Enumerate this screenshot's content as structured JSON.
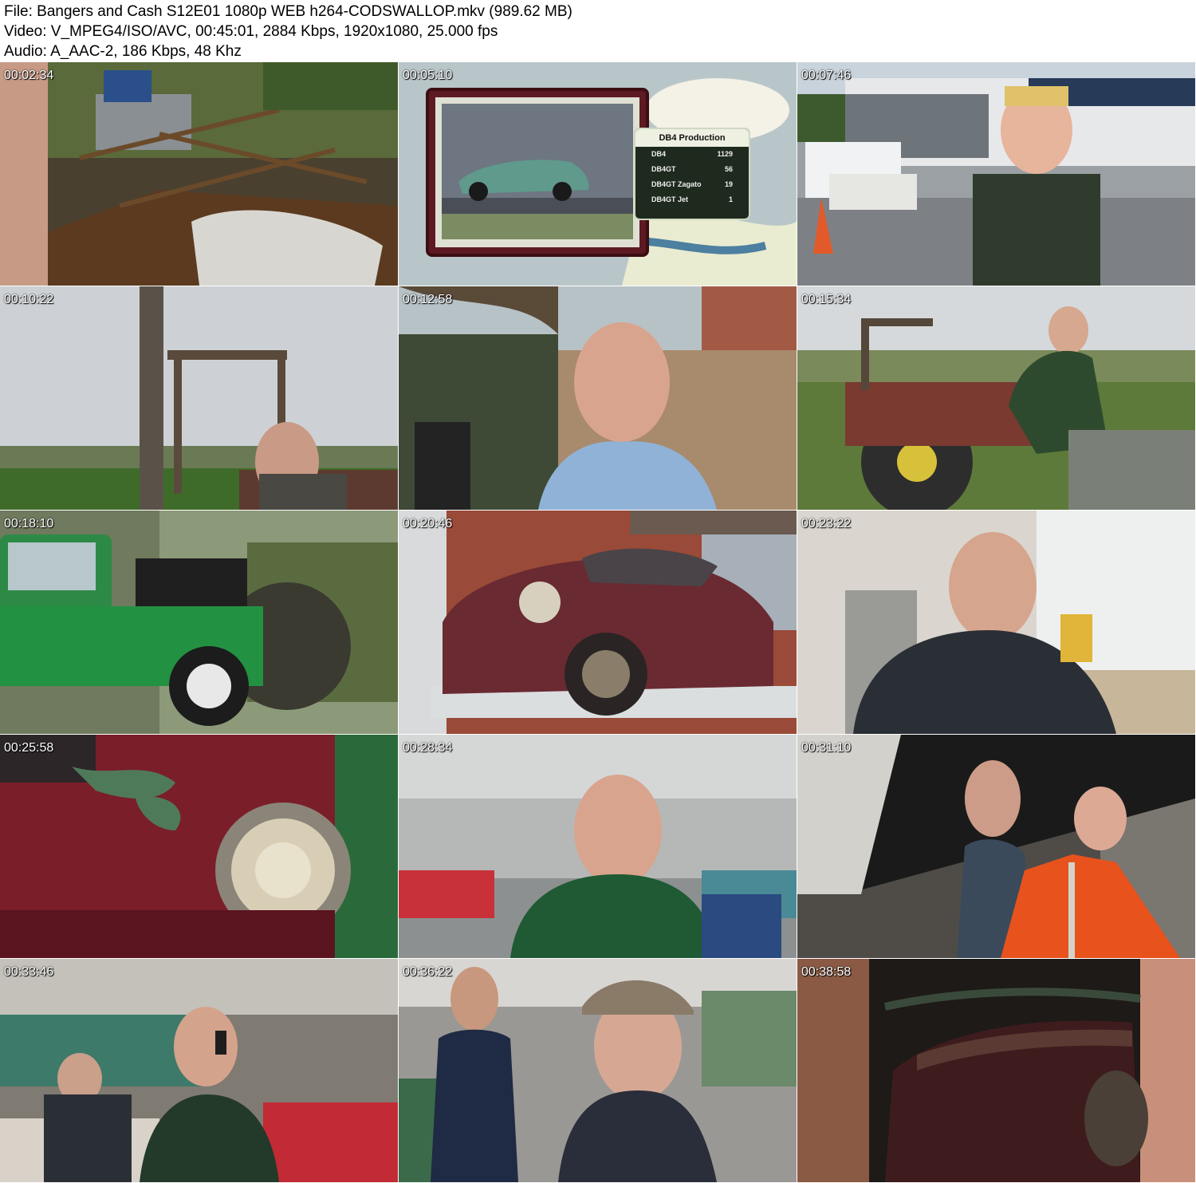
{
  "header": {
    "file_line": "File: Bangers and Cash S12E01 1080p WEB h264-CODSWALLOP.mkv (989.62 MB)",
    "video_line": "Video: V_MPEG4/ISO/AVC, 00:45:01, 2884 Kbps, 1920x1080, 25.000 fps",
    "audio_line": "Audio: A_AAC-2, 186 Kbps, 48 Khz"
  },
  "thumbnails": [
    {
      "timestamp": "00:02:34",
      "scene": "overgrown-wreck"
    },
    {
      "timestamp": "00:05:10",
      "scene": "db4-production-graphic"
    },
    {
      "timestamp": "00:07:46",
      "scene": "garage-forecourt"
    },
    {
      "timestamp": "00:10:22",
      "scene": "tractor-field"
    },
    {
      "timestamp": "00:12:58",
      "scene": "man-garden"
    },
    {
      "timestamp": "00:15:34",
      "scene": "tractor-driver"
    },
    {
      "timestamp": "00:18:10",
      "scene": "green-land-rover"
    },
    {
      "timestamp": "00:20:46",
      "scene": "red-aston-on-truck"
    },
    {
      "timestamp": "00:23:22",
      "scene": "bald-man-office"
    },
    {
      "timestamp": "00:25:58",
      "scene": "headlight-closeup"
    },
    {
      "timestamp": "00:28:34",
      "scene": "auction-hall"
    },
    {
      "timestamp": "00:31:10",
      "scene": "men-under-lid"
    },
    {
      "timestamp": "00:33:46",
      "scene": "phone-bidding"
    },
    {
      "timestamp": "00:36:22",
      "scene": "two-men-hall"
    },
    {
      "timestamp": "00:38:58",
      "scene": "dark-car-detail"
    }
  ],
  "db4_panel": {
    "title": "DB4 Production",
    "rows": [
      {
        "name": "DB4",
        "value": "1129"
      },
      {
        "name": "DB4GT",
        "value": "56"
      },
      {
        "name": "DB4GT Zagato",
        "value": "19"
      },
      {
        "name": "DB4GT Jet",
        "value": "1"
      }
    ]
  },
  "colors": {
    "background": "#ffffff",
    "header_text": "#000000",
    "timestamp_text": "#ffffff",
    "panel_bg": "#1f2a1f",
    "panel_title_bg": "#eef0e2"
  }
}
